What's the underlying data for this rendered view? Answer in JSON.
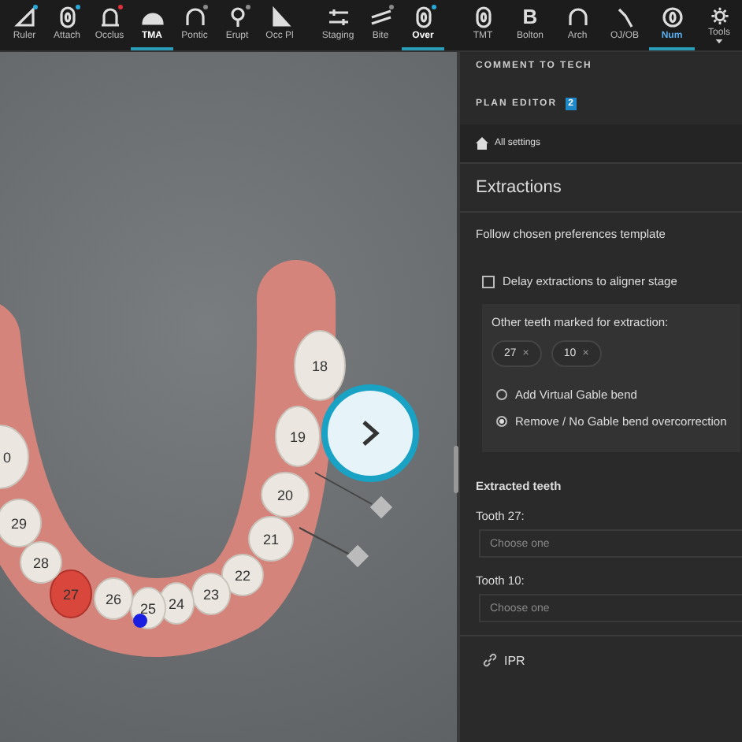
{
  "toolbar": {
    "left_tools": [
      {
        "label": "Ruler",
        "selected": false,
        "color": "#2aa8d8"
      },
      {
        "label": "Attach",
        "selected": false,
        "color": "#2aa8d8"
      },
      {
        "label": "Occlus",
        "selected": false,
        "color": "#e0303a"
      },
      {
        "label": "TMA",
        "selected": true
      },
      {
        "label": "Pontic",
        "selected": false,
        "color": "#8a8a8a"
      },
      {
        "label": "Erupt",
        "selected": false,
        "color": "#8a8a8a"
      },
      {
        "label": "Occ Pl",
        "selected": false
      },
      {
        "label": "Staging",
        "selected": false
      },
      {
        "label": "Bite",
        "selected": false,
        "color": "#8a8a8a"
      },
      {
        "label": "Over",
        "selected": true,
        "color": "#2aa8d8"
      }
    ],
    "right_tools": [
      {
        "label": "TMT",
        "selected": false
      },
      {
        "label": "Bolton",
        "glyph": "B",
        "selected": false
      },
      {
        "label": "Arch",
        "selected": false
      },
      {
        "label": "OJ/OB",
        "selected": false
      },
      {
        "label": "Num",
        "selected": true
      },
      {
        "label": "Tools",
        "selected": false
      }
    ]
  },
  "canvas": {
    "teeth": [
      {
        "number": "18",
        "marked": false
      },
      {
        "number": "19",
        "marked": false
      },
      {
        "number": "20",
        "marked": false
      },
      {
        "number": "21",
        "marked": false
      },
      {
        "number": "22",
        "marked": false
      },
      {
        "number": "23",
        "marked": false
      },
      {
        "number": "24",
        "marked": false
      },
      {
        "number": "25",
        "marked": false
      },
      {
        "number": "26",
        "marked": false
      },
      {
        "number": "27",
        "marked": true
      },
      {
        "number": "28",
        "marked": false
      },
      {
        "number": "29",
        "marked": false
      },
      {
        "number": "0",
        "marked": false
      }
    ]
  },
  "panel": {
    "sections": [
      "COMMENT TO TECH",
      "PLAN EDITOR"
    ],
    "plan_editor_badge": "2",
    "breadcrumb": "All settings",
    "title": "Extractions",
    "template_note": "Follow chosen preferences template",
    "delay_checkbox": {
      "label": "Delay extractions to aligner stage",
      "checked": false
    },
    "other_teeth": {
      "label": "Other teeth marked for extraction:",
      "chips": [
        {
          "text": "27",
          "remove": "×"
        },
        {
          "text": "10",
          "remove": "×"
        }
      ],
      "options": [
        {
          "label": "Add Virtual Gable bend",
          "selected": false
        },
        {
          "label": "Remove / No Gable bend overcorrection",
          "selected": true
        }
      ]
    },
    "extracted_heading": "Extracted teeth",
    "selects": [
      {
        "label": "Tooth 27:",
        "placeholder": "Choose one"
      },
      {
        "label": "Tooth 10:",
        "placeholder": "Choose one"
      }
    ],
    "ipr_link": "IPR"
  }
}
